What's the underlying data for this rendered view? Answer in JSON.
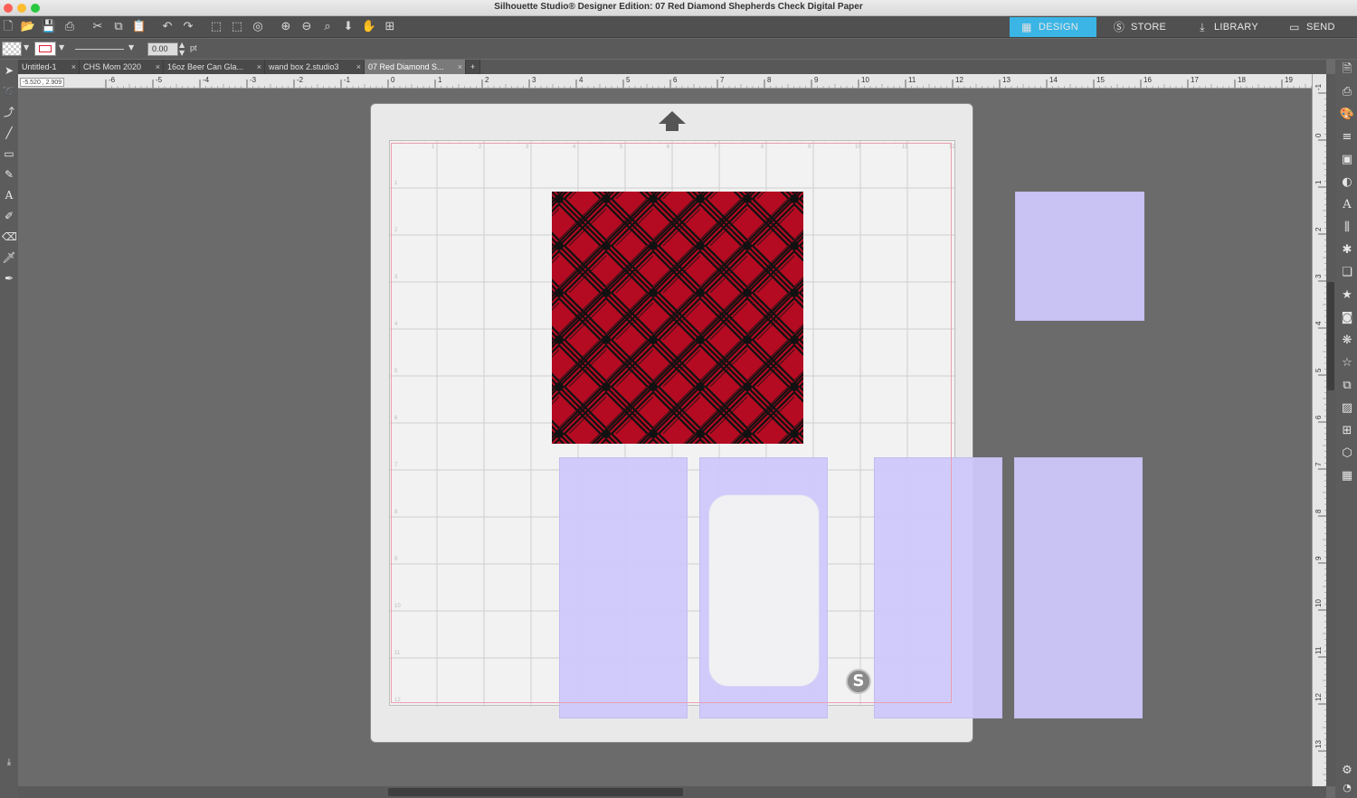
{
  "window": {
    "title": "Silhouette Studio® Designer Edition: 07 Red Diamond Shepherds Check Digital Paper",
    "traffic_colors": [
      "#fe5f57",
      "#febc2e",
      "#28c840"
    ]
  },
  "nav_tabs": [
    {
      "label": "DESIGN",
      "icon": "grid-icon",
      "active": true
    },
    {
      "label": "STORE",
      "icon": "silhouette-s-icon",
      "active": false
    },
    {
      "label": "LIBRARY",
      "icon": "download-icon",
      "active": false
    },
    {
      "label": "SEND",
      "icon": "cutter-icon",
      "active": false
    }
  ],
  "line_style": {
    "weight_value": "0.00",
    "unit": "pt"
  },
  "doc_tabs": [
    {
      "label": "Untitled-1",
      "active": false
    },
    {
      "label": "CHS Mom 2020",
      "active": false
    },
    {
      "label": "16oz Beer Can Gla...",
      "active": false
    },
    {
      "label": "wand box 2.studio3",
      "active": false
    },
    {
      "label": "07 Red Diamond S...",
      "active": true
    }
  ],
  "add_tab_label": "+",
  "close_tab_label": "×",
  "cursor_readout": "-5.520 , 2.909",
  "ruler": {
    "h_labels": [
      "-6",
      "-5",
      "-4",
      "-3",
      "-2",
      "-1",
      "0",
      "1",
      "2",
      "3",
      "4",
      "5",
      "6",
      "7",
      "8",
      "9",
      "10",
      "11",
      "12",
      "13",
      "14",
      "15",
      "16",
      "17",
      "18",
      "19"
    ],
    "v_labels": [
      "-1",
      "0",
      "1",
      "2",
      "3",
      "4",
      "5",
      "6",
      "7",
      "8",
      "9",
      "10",
      "11",
      "12",
      "13"
    ]
  },
  "mat_grid": {
    "top_labels": [
      "1",
      "2",
      "3",
      "4",
      "5",
      "6",
      "7",
      "8",
      "9",
      "10",
      "11",
      "12"
    ],
    "side_labels": [
      "1",
      "2",
      "3",
      "4",
      "5",
      "6",
      "7",
      "8",
      "9",
      "10",
      "11",
      "12"
    ]
  },
  "colors": {
    "accent": "#3ab5e5",
    "plaid_red": "#b40b22",
    "plaid_black": "#111111",
    "shape_fill": "#cfcbfa",
    "cut_border": "#e8a0b0"
  },
  "icons": {
    "feed_arrow": "arrow-up-icon",
    "logo": "silhouette-logo-icon"
  }
}
